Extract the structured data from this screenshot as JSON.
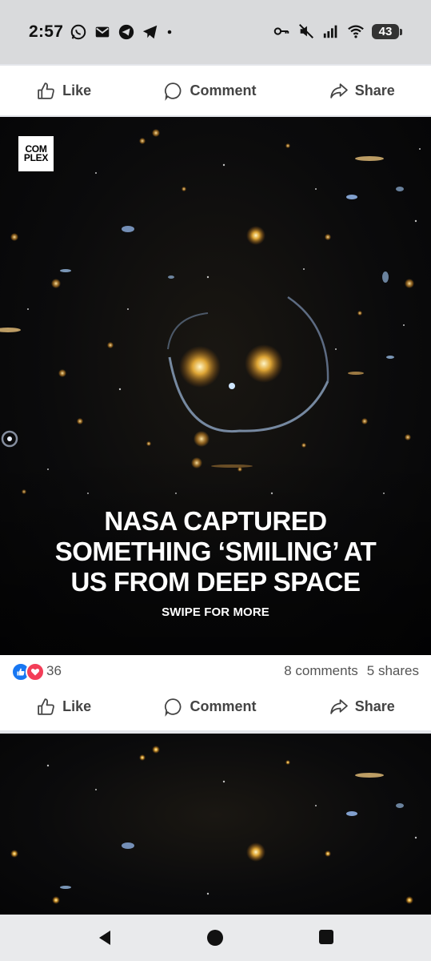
{
  "status_bar": {
    "time": "2:57",
    "battery": "43",
    "icons_left": [
      "whatsapp-icon",
      "gmail-icon",
      "telegram-icon",
      "telegram-icon",
      "dot-icon"
    ],
    "icons_right": [
      "key-icon",
      "mute-icon",
      "signal-icon",
      "wifi-icon",
      "battery-icon"
    ]
  },
  "actions": {
    "like": "Like",
    "comment": "Comment",
    "share": "Share"
  },
  "post": {
    "brand": [
      "COM",
      "PLEX"
    ],
    "headline": [
      "NASA CAPTURED",
      "SOMETHING ‘SMILING’ AT",
      "US FROM DEEP SPACE"
    ],
    "swipe": "SWIPE FOR MORE",
    "reaction_count": "36",
    "comments": "8 comments",
    "shares": "5 shares"
  },
  "colors": {
    "like_blue": "#1877f2",
    "love_red": "#f33e58",
    "text_gray": "#444444"
  }
}
